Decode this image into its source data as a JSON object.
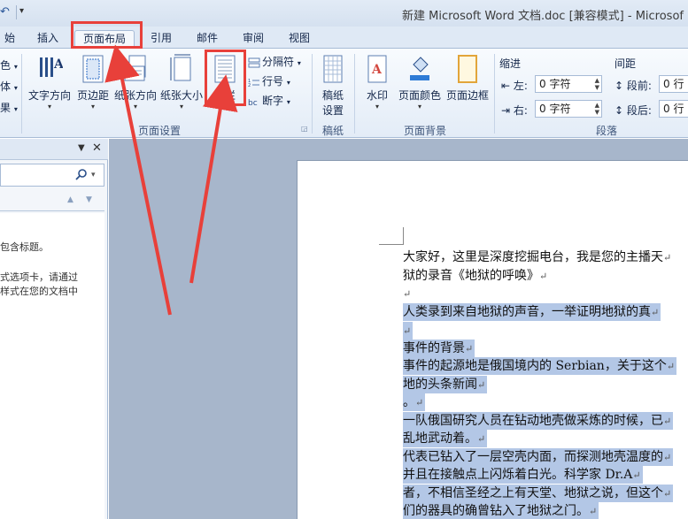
{
  "window": {
    "title": "新建 Microsoft Word 文档.doc [兼容模式] - Microsof"
  },
  "tabs": [
    {
      "label": "始"
    },
    {
      "label": "插入"
    },
    {
      "label": "页面布局",
      "active": true
    },
    {
      "label": "引用"
    },
    {
      "label": "邮件"
    },
    {
      "label": "审阅"
    },
    {
      "label": "视图"
    }
  ],
  "ribbon": {
    "left_cut": [
      "色",
      "体",
      "果"
    ],
    "page_setup": {
      "label": "页面设置",
      "text_direction": "文字方向",
      "margins": "页边距",
      "orientation": "纸张方向",
      "size": "纸张大小",
      "columns": "分栏",
      "breaks": "分隔符",
      "line_numbers": "行号",
      "hyphenation": "断字"
    },
    "draft": {
      "label": "稿纸",
      "button_line1": "稿纸",
      "button_line2": "设置"
    },
    "page_background": {
      "label": "页面背景",
      "watermark": "水印",
      "page_color": "页面颜色",
      "page_borders": "页面边框"
    },
    "paragraph": {
      "label": "段落",
      "indent_title": "缩进",
      "spacing_title": "间距",
      "left_label": "左:",
      "left_value": "0 字符",
      "right_label": "右:",
      "right_value": "0 字符",
      "before_label": "段前:",
      "before_value": "0 行",
      "after_label": "段后:",
      "after_value": "0 行"
    }
  },
  "nav_pane": {
    "lines": [
      "包含标题。",
      "式选项卡，请通过",
      "样式在您的文档中"
    ]
  },
  "document": {
    "lines": [
      {
        "text": "大家好，这里是深度挖掘电台，我是您的主播天",
        "selected": false
      },
      {
        "text": "狱的录音《地狱的呼唤》",
        "selected": false
      },
      {
        "text": "",
        "selected": false
      },
      {
        "text": "人类录到来自地狱的声音，一举证明地狱的真",
        "selected": true
      },
      {
        "text": "",
        "selected": true
      },
      {
        "text": "事件的背景",
        "selected": true
      },
      {
        "text": "事件的起源地是俄国境内的 Serbian，关于这个",
        "selected": true
      },
      {
        "text": "地的头条新闻",
        "selected": true
      },
      {
        "text": "。",
        "selected": true
      },
      {
        "text": "一队俄国研究人员在钻动地壳做采炼的时候，已",
        "selected": true
      },
      {
        "text": "乱地武动着。",
        "selected": true
      },
      {
        "text": "代表已钻入了一层空壳内面，而探测地壳温度的",
        "selected": true
      },
      {
        "text": "并且在接触点上闪烁着白光。科学家 Dr.A",
        "selected": true
      },
      {
        "text": "者，不相信圣经之上有天堂、地狱之说，但这个",
        "selected": true
      },
      {
        "text": "们的器具的确曾钻入了地狱之门。",
        "selected": true
      }
    ]
  },
  "colors": {
    "highlight": "#e8403a",
    "selection": "#b3c7e6"
  }
}
